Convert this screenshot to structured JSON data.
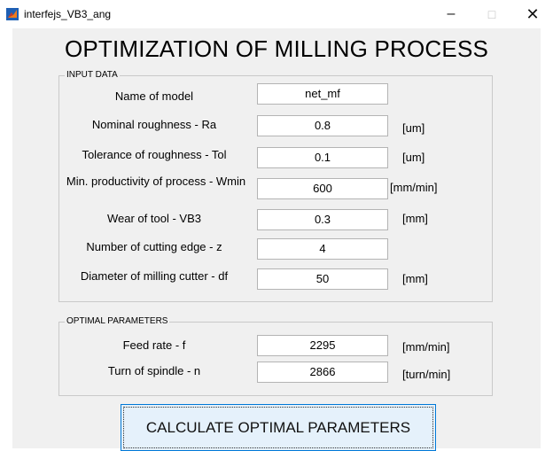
{
  "window": {
    "title": "interfejs_VB3_ang",
    "controls": {
      "minimize": "–",
      "maximize": "□",
      "close": "✕"
    }
  },
  "app": {
    "title": "OPTIMIZATION OF MILLING PROCESS"
  },
  "input_panel": {
    "title": "INPUT DATA",
    "rows": [
      {
        "label": "Name of model",
        "value": "net_mf",
        "unit": ""
      },
      {
        "label": "Nominal roughness - Ra",
        "value": "0.8",
        "unit": "[um]"
      },
      {
        "label": "Tolerance of roughness - Tol",
        "value": "0.1",
        "unit": "[um]"
      },
      {
        "label": "Min. productivity of process - Wmin",
        "value": "600",
        "unit": "[mm/min]"
      },
      {
        "label": "Wear of tool - VB3",
        "value": "0.3",
        "unit": "[mm]"
      },
      {
        "label": "Number of cutting edge - z",
        "value": "4",
        "unit": ""
      },
      {
        "label": "Diameter of milling cutter - df",
        "value": "50",
        "unit": "[mm]"
      }
    ]
  },
  "output_panel": {
    "title": "OPTIMAL PARAMETERS",
    "rows": [
      {
        "label": "Feed rate - f",
        "value": "2295",
        "unit": "[mm/min]"
      },
      {
        "label": "Turn of spindle - n",
        "value": "2866",
        "unit": "[turn/min]"
      }
    ]
  },
  "actions": {
    "calculate_label": "CALCULATE OPTIMAL PARAMETERS"
  },
  "colors": {
    "window_bg": "#f0f0f0",
    "button_bg": "#e5f1fb",
    "button_border": "#0078d7"
  }
}
